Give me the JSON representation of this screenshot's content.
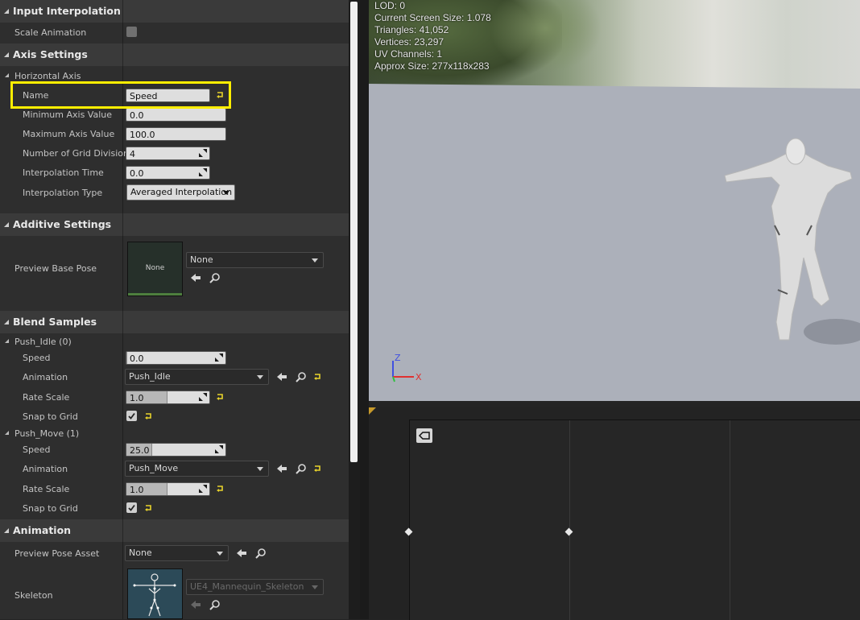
{
  "details": {
    "input_interpolation": {
      "title": "Input Interpolation",
      "scale_animation_label": "Scale Animation",
      "scale_animation_checked": false
    },
    "axis_settings": {
      "title": "Axis Settings",
      "group_label": "Horizontal Axis",
      "name_label": "Name",
      "name_value": "Speed",
      "min_label": "Minimum Axis Value",
      "min_value": "0.0",
      "max_label": "Maximum Axis Value",
      "max_value": "100.0",
      "divisions_label": "Number of Grid Divisions",
      "divisions_value": "4",
      "interp_time_label": "Interpolation Time",
      "interp_time_value": "0.0",
      "interp_type_label": "Interpolation Type",
      "interp_type_value": "Averaged Interpolation"
    },
    "additive_settings": {
      "title": "Additive Settings",
      "preview_base_pose_label": "Preview Base Pose",
      "thumb_text": "None",
      "combo_value": "None"
    },
    "blend_samples": {
      "title": "Blend Samples",
      "samples": [
        {
          "header": "Push_Idle (0)",
          "speed_label": "Speed",
          "speed_value": "0.0",
          "speed_fraction": 0.0,
          "animation_label": "Animation",
          "animation_value": "Push_Idle",
          "rate_label": "Rate Scale",
          "rate_value": "1.0",
          "snap_label": "Snap to Grid",
          "snap_checked": true
        },
        {
          "header": "Push_Move (1)",
          "speed_label": "Speed",
          "speed_value": "25.0",
          "speed_fraction": 0.25,
          "animation_label": "Animation",
          "animation_value": "Push_Move",
          "rate_label": "Rate Scale",
          "rate_value": "1.0",
          "snap_label": "Snap to Grid",
          "snap_checked": true
        }
      ]
    },
    "animation": {
      "title": "Animation",
      "preview_pose_label": "Preview Pose Asset",
      "preview_pose_value": "None",
      "skeleton_label": "Skeleton",
      "skeleton_value": "UE4_Mannequin_Skeleton"
    }
  },
  "viewport": {
    "stats": [
      "LOD: 0",
      "Current Screen Size: 1.078",
      "Triangles: 41,052",
      "Vertices: 23,297",
      "UV Channels: 1",
      "Approx Size: 277x118x283"
    ],
    "axis_labels": {
      "z": "Z",
      "x": "X"
    }
  },
  "colors": {
    "highlight": "#ffee00",
    "reset_arrow": "#e8d32b",
    "axis_x": "#e03030",
    "axis_y": "#30c040",
    "axis_z": "#4050e0"
  }
}
